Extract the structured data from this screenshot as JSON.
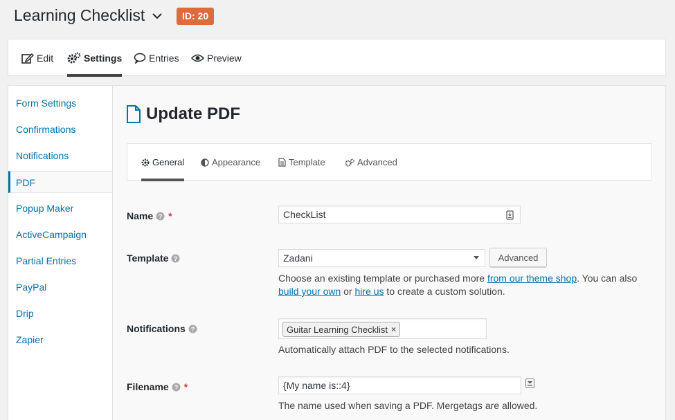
{
  "header": {
    "form_title": "Learning Checklist",
    "id_badge": "ID: 20"
  },
  "toolbar": {
    "items": [
      {
        "label": "Edit",
        "icon": "edit-icon"
      },
      {
        "label": "Settings",
        "icon": "gears-icon",
        "active": true
      },
      {
        "label": "Entries",
        "icon": "speech-bubble-icon"
      },
      {
        "label": "Preview",
        "icon": "eye-icon"
      }
    ]
  },
  "sidebar": {
    "items": [
      {
        "label": "Form Settings"
      },
      {
        "label": "Confirmations"
      },
      {
        "label": "Notifications"
      },
      {
        "label": "PDF",
        "active": true
      },
      {
        "label": "Popup Maker"
      },
      {
        "label": "ActiveCampaign"
      },
      {
        "label": "Partial Entries"
      },
      {
        "label": "PayPal"
      },
      {
        "label": "Drip"
      },
      {
        "label": "Zapier"
      }
    ]
  },
  "main": {
    "page_title": "Update PDF",
    "tabs": [
      {
        "label": "General",
        "icon": "gear-icon",
        "active": true
      },
      {
        "label": "Appearance",
        "icon": "contrast-icon"
      },
      {
        "label": "Template",
        "icon": "document-icon"
      },
      {
        "label": "Advanced",
        "icon": "gears-icon"
      }
    ],
    "fields": {
      "name": {
        "label": "Name",
        "value": "CheckList"
      },
      "template": {
        "label": "Template",
        "selected": "Zadani",
        "advanced_button": "Advanced",
        "desc_part1": "Choose an existing template or purchased more ",
        "desc_link1": "from our theme shop",
        "desc_part2": ". You can also ",
        "desc_link2": "build your own",
        "desc_part3": " or ",
        "desc_link3": "hire us",
        "desc_part4": " to create a custom solution."
      },
      "notifications": {
        "label": "Notifications",
        "token": "Guitar Learning Checklist",
        "token_remove": "×",
        "desc": "Automatically attach PDF to the selected notifications."
      },
      "filename": {
        "label": "Filename",
        "value": "{My name is::4}",
        "desc": "The name used when saving a PDF. Mergetags are allowed."
      }
    },
    "required_mark": "*"
  },
  "colors": {
    "accent": "#0073aa",
    "badge": "#dd6b40",
    "required": "#dc3232"
  }
}
